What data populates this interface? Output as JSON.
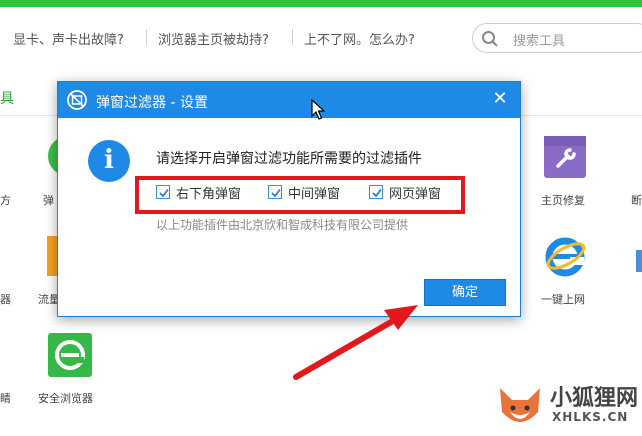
{
  "topbar": {
    "links": [
      "显卡、声卡出故障?",
      "浏览器主页被劫持?",
      "上不了网。怎么办?"
    ],
    "search_placeholder": "搜索工具"
  },
  "section": {
    "label": "具"
  },
  "tiles": {
    "homepage_repair": "主页修复",
    "one_click_online": "一键上网",
    "secure_browser": "安全浏览器",
    "partial_left_1": "方",
    "partial_left_2": "器",
    "partial_left_3": "睛",
    "partial_right_1": "断",
    "partial_mid_1": "弹",
    "partial_mid_2": "流量"
  },
  "dialog": {
    "title": "弹窗过滤器 - 设置",
    "close_label": "✕",
    "prompt": "请选择开启弹窗过滤功能所需要的过滤插件",
    "options": [
      {
        "label": "右下角弹窗",
        "checked": true
      },
      {
        "label": "中间弹窗",
        "checked": true
      },
      {
        "label": "网页弹窗",
        "checked": true
      }
    ],
    "note": "以上功能插件由北京欣和智成科技有限公司提供",
    "ok_label": "确定"
  },
  "watermark": {
    "cn": "小狐狸网",
    "en": "XHLKS.CN"
  },
  "colors": {
    "accent_green": "#2fc437",
    "dialog_blue": "#1e8ae6",
    "highlight_red": "#e2181c"
  }
}
